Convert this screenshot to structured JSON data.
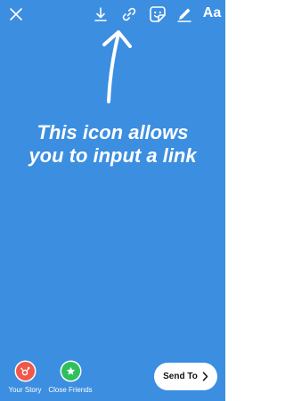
{
  "app": {
    "background_color": "#3B8EE0"
  },
  "toolbar": {
    "text_tool_label": "Aa",
    "icons": [
      "close-icon",
      "download-icon",
      "link-icon",
      "sticker-icon",
      "draw-icon",
      "text-icon"
    ]
  },
  "annotation": {
    "line1": "This icon allows",
    "line2": "you to input a link"
  },
  "share": {
    "your_story_label": "Your Story",
    "close_friends_label": "Close Friends",
    "send_label": "Send To",
    "your_story_color": "#F0584C",
    "close_friends_color": "#2EC05C"
  }
}
